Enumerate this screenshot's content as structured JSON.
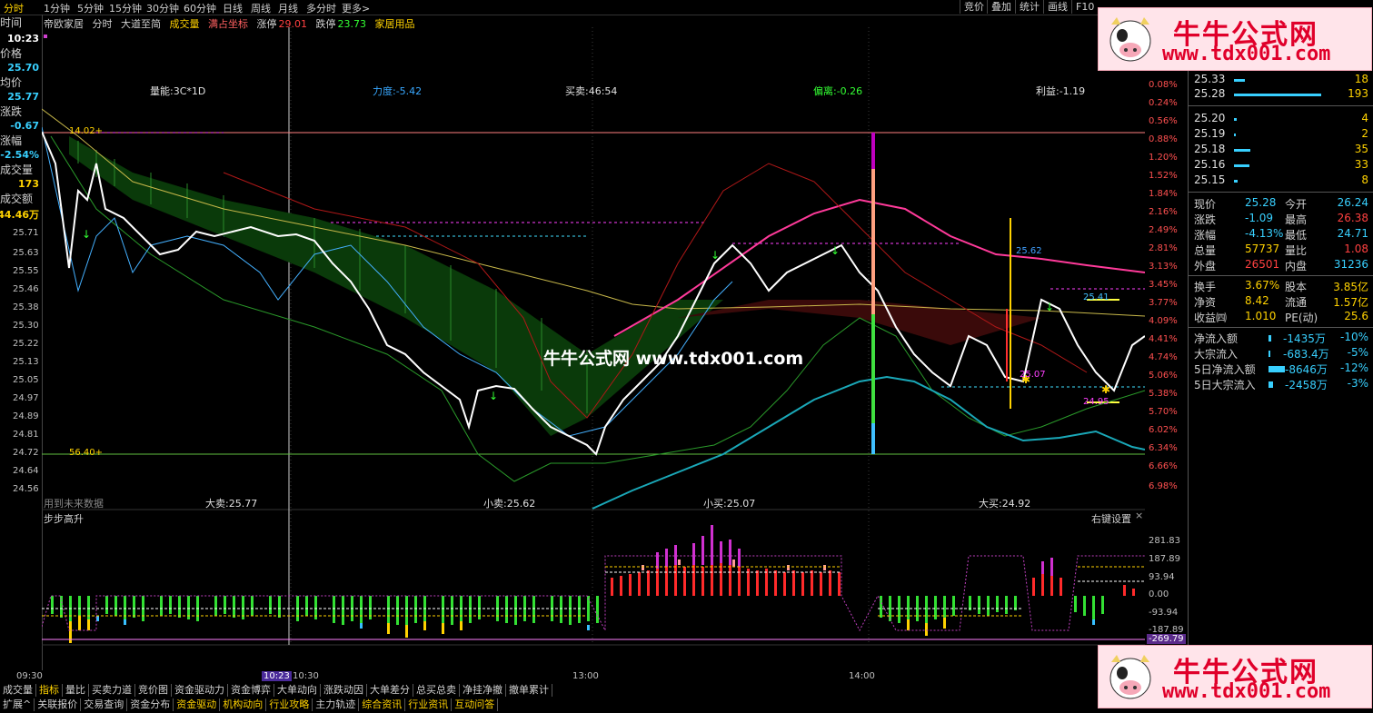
{
  "top_tabs": [
    "分时",
    "1分钟",
    "5分钟",
    "15分钟",
    "30分钟",
    "60分钟",
    "日线",
    "周线",
    "月线",
    "多分时",
    "更多>"
  ],
  "top_right_tabs": [
    "竞价",
    "叠加",
    "统计",
    "画线",
    "F10"
  ],
  "left_panel": {
    "time_label": "时间",
    "time_value": "10:23",
    "price_label": "价格",
    "price_value": "25.70",
    "avg_label": "均价",
    "avg_value": "25.77",
    "chg_label": "涨跌",
    "chg_value": "-0.67",
    "pct_label": "涨幅",
    "pct_value": "-2.54%",
    "vol_label": "成交量",
    "vol_value": "173",
    "amt_label": "成交额",
    "amt_value": "44.46万"
  },
  "chart_title": {
    "stock": "帝欧家居",
    "mode": "分时",
    "formula": "大道至简",
    "vol": "成交量",
    "full": "满占坐标",
    "limit_up_label": "涨停",
    "limit_up": "29.01",
    "limit_down_label": "跌停",
    "limit_down": "23.73",
    "sector": "家居用品"
  },
  "indicator_labels": {
    "liangneng": "量能:3C*1D",
    "lidu": "力度:-5.42",
    "maimai": "买卖:46:54",
    "pianli": "偏离:-0.26",
    "liyi": "利益:-1.19",
    "dasell": "大卖:25.77",
    "xiaosell": "小卖:25.62",
    "xiaobuy": "小买:25.07",
    "dabuy": "大买:24.92",
    "future": "用到未来数据",
    "top_ref": "14.02+",
    "bottom_ref": "56.40+",
    "p1": "25.62",
    "p2": "25.41",
    "p3": "24.95",
    "p4": "25.07"
  },
  "price_axis": [
    "25.71",
    "25.63",
    "25.55",
    "25.46",
    "25.38",
    "25.30",
    "25.22",
    "25.13",
    "25.05",
    "24.97",
    "24.89",
    "24.81",
    "24.72",
    "24.64",
    "24.56"
  ],
  "pct_axis": [
    "0.08%",
    "0.24%",
    "0.56%",
    "0.88%",
    "1.20%",
    "1.52%",
    "1.84%",
    "2.16%",
    "2.49%",
    "2.81%",
    "3.13%",
    "3.45%",
    "3.77%",
    "4.09%",
    "4.41%",
    "4.74%",
    "5.06%",
    "5.38%",
    "5.70%",
    "6.02%",
    "6.34%",
    "6.66%",
    "6.98%"
  ],
  "sub_chart": {
    "title": "步步高升",
    "settings": "右键设置",
    "axis": [
      "281.83",
      "187.89",
      "93.94",
      "0.00",
      "-93.94",
      "-187.89",
      "-269.79"
    ]
  },
  "time_axis": {
    "t0": "09:30",
    "cursor": "10:23",
    "t1": "10:30",
    "t2": "13:00",
    "t3": "14:00"
  },
  "bottom_tabs1": [
    "成交量",
    "指标",
    "量比",
    "买卖力道",
    "竞价图",
    "资金驱动力",
    "资金博弈",
    "大单动向",
    "涨跌动因",
    "大单差分",
    "总买总卖",
    "净挂净撤",
    "撤单累计"
  ],
  "bottom_tabs2": [
    "扩展^",
    "关联报价",
    "交易查询",
    "资金分布",
    "资金驱动",
    "机构动向",
    "行业攻略",
    "主力轨迹",
    "综合资讯",
    "行业资讯",
    "互动问答"
  ],
  "order_book": [
    {
      "price": "25.33",
      "vol": "18",
      "bar": 0.09
    },
    {
      "price": "25.28",
      "vol": "193",
      "bar": 1.0
    },
    {
      "price": "25.20",
      "vol": "4",
      "bar": 0.02
    },
    {
      "price": "25.19",
      "vol": "2",
      "bar": 0.01
    },
    {
      "price": "25.18",
      "vol": "35",
      "bar": 0.18
    },
    {
      "price": "25.16",
      "vol": "33",
      "bar": 0.17
    },
    {
      "price": "25.15",
      "vol": "8",
      "bar": 0.04
    }
  ],
  "quote": {
    "xj_l": "现价",
    "xj": "25.28",
    "jk_l": "今开",
    "jk": "26.24",
    "zd_l": "涨跌",
    "zd": "-1.09",
    "zg_l": "最高",
    "zg": "26.38",
    "zf_l": "涨幅",
    "zf": "-4.13%",
    "zdi_l": "最低",
    "zdi": "24.71",
    "zl_l": "总量",
    "zl": "57737",
    "lb_l": "量比",
    "lb": "1.08",
    "wp_l": "外盘",
    "wp": "26501",
    "np_l": "内盘",
    "np": "31236",
    "hs_l": "换手",
    "hs": "3.67%",
    "gb_l": "股本",
    "gb": "3.85亿",
    "jz_l": "净资",
    "jz": "8.42",
    "lt_l": "流通",
    "lt": "1.57亿",
    "sy_l": "收益㈣",
    "sy": "1.010",
    "pe_l": "PE(动)",
    "pe": "25.6"
  },
  "flows": [
    {
      "label": "净流入额",
      "value": "-1435万",
      "pct": "-10%"
    },
    {
      "label": "大宗流入",
      "value": "-683.4万",
      "pct": "-5%"
    },
    {
      "label": "5日净流入额",
      "value": "-8646万",
      "pct": "-12%"
    },
    {
      "label": "5日大宗流入",
      "value": "-2458万",
      "pct": "-3%"
    }
  ],
  "watermark": {
    "cn": "牛牛公式网",
    "url": "www.tdx001.com"
  },
  "center_watermark": "牛牛公式网 www.tdx001.com",
  "colors": {
    "up": "#ff3c3c",
    "down": "#33ff33",
    "cyan": "#38d0ff",
    "yellow": "#ffd200",
    "magenta": "#ff40a0"
  }
}
